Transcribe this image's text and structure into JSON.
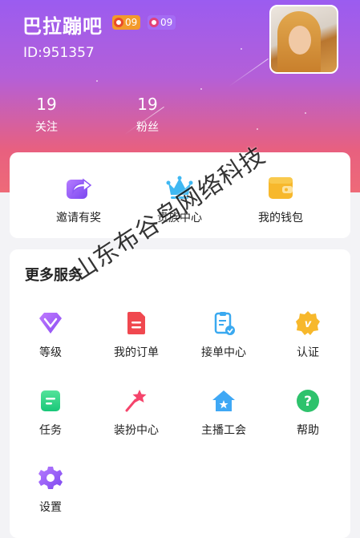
{
  "profile": {
    "username": "巴拉蹦吧",
    "badges": [
      {
        "value": "09",
        "color": "#f39a2b"
      },
      {
        "value": "09",
        "color": "#a56cf4"
      }
    ],
    "id_text": "ID:951357",
    "stats": [
      {
        "value": "19",
        "label": "关注"
      },
      {
        "value": "19",
        "label": "粉丝"
      }
    ]
  },
  "quick_actions": [
    {
      "label": "邀请有奖",
      "icon": "share-icon"
    },
    {
      "label": "贵族中心",
      "icon": "crown-icon"
    },
    {
      "label": "我的钱包",
      "icon": "wallet-icon"
    }
  ],
  "services": {
    "title": "更多服务",
    "items": [
      {
        "label": "等级",
        "icon": "diamond-icon"
      },
      {
        "label": "我的订单",
        "icon": "order-icon"
      },
      {
        "label": "接单中心",
        "icon": "clipboard-check-icon"
      },
      {
        "label": "认证",
        "icon": "verified-badge-icon"
      },
      {
        "label": "任务",
        "icon": "task-icon"
      },
      {
        "label": "装扮中心",
        "icon": "magic-wand-icon"
      },
      {
        "label": "主播工会",
        "icon": "house-star-icon"
      },
      {
        "label": "帮助",
        "icon": "help-icon"
      },
      {
        "label": "设置",
        "icon": "settings-gear-icon"
      }
    ]
  },
  "watermark": "山东布谷鸟网络科技",
  "colors": {
    "header_top": "#9b5cf0",
    "header_bottom": "#ee6a78",
    "crown": "#3fb8f2",
    "wallet": "#f7b82c"
  }
}
